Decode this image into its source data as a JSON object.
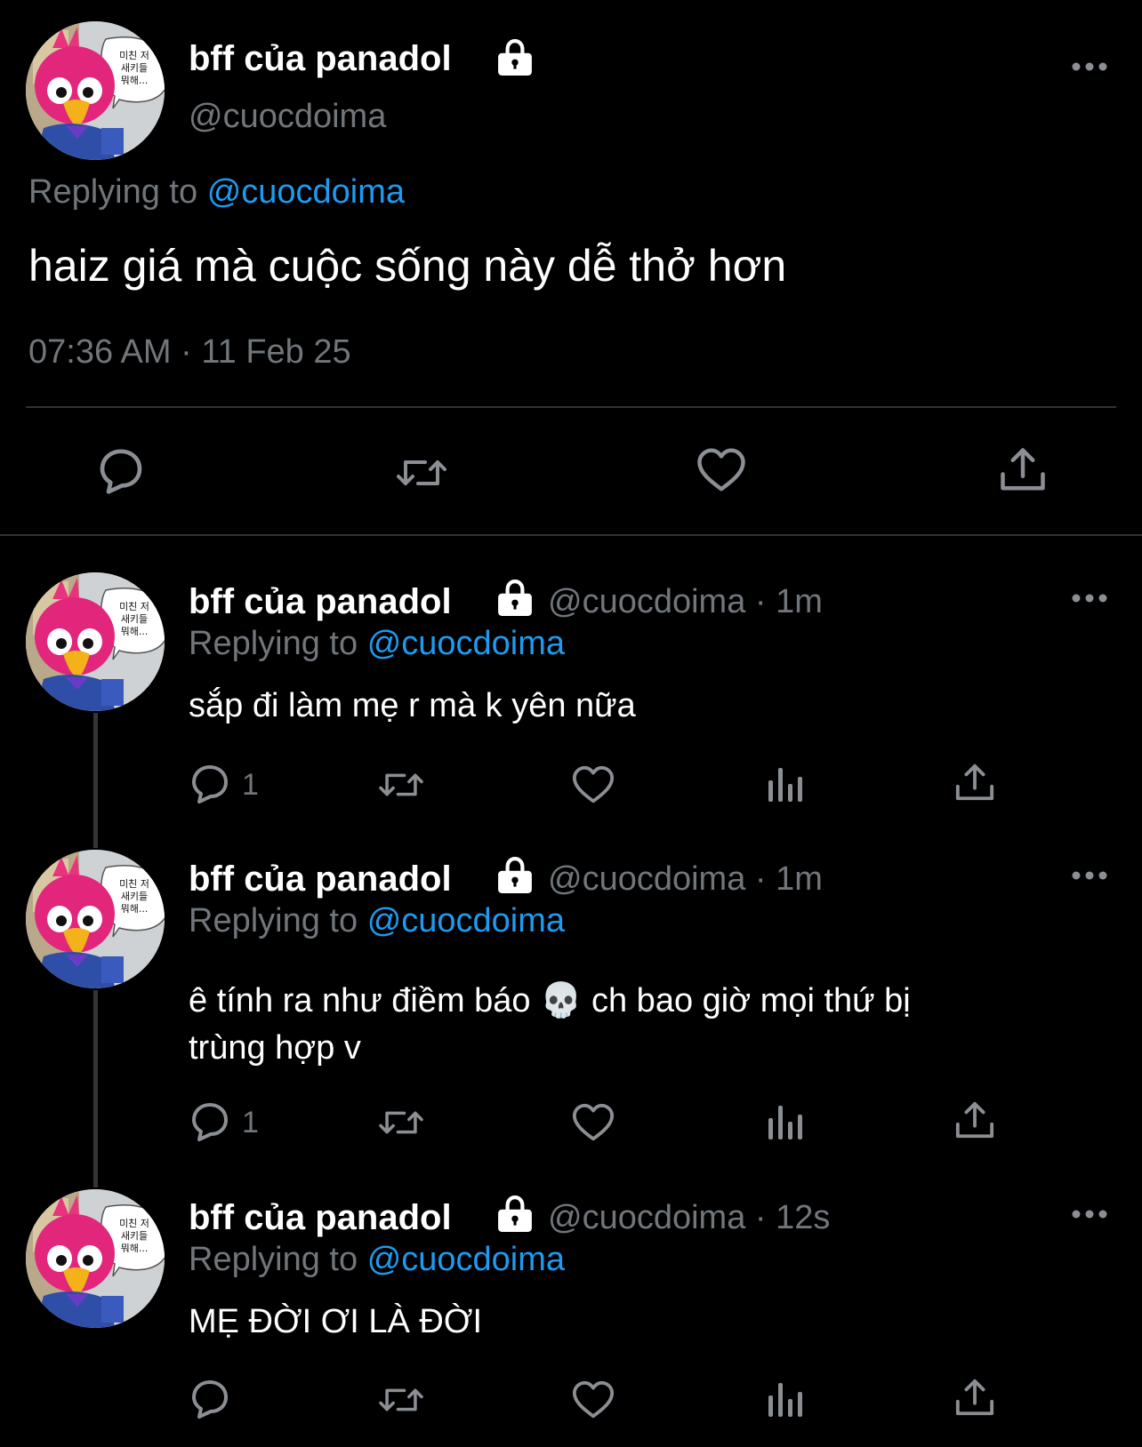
{
  "main_tweet": {
    "display_name": "bff của panadol",
    "handle": "@cuocdoima",
    "replying_prefix": "Replying to",
    "replying_handle": "@cuocdoima",
    "text": "haiz giá mà cuộc sống này dễ thở hơn",
    "timestamp": "07:36 AM · 11 Feb 25"
  },
  "avatar_speech": "미친 저\n새키들\n뭐해...",
  "replies": [
    {
      "display_name": "bff của panadol",
      "meta": "@cuocdoima · 1m",
      "replying_prefix": "Replying to",
      "replying_handle": "@cuocdoima",
      "text_lines": [
        "sắp đi làm mẹ r mà k yên nữa"
      ],
      "reply_count": "1"
    },
    {
      "display_name": "bff của panadol",
      "meta": "@cuocdoima · 1m",
      "replying_prefix": "Replying to",
      "replying_handle": "@cuocdoima",
      "text_lines": [
        "ê tính ra như điềm báo 💀  ch bao giờ mọi thứ bị",
        "trùng hợp v"
      ],
      "reply_count": "1"
    },
    {
      "display_name": "bff của panadol",
      "meta": "@cuocdoima · 12s",
      "replying_prefix": "Replying to",
      "replying_handle": "@cuocdoima",
      "text_lines": [
        "MẸ ĐỜI ƠI LÀ ĐỜI"
      ],
      "reply_count": ""
    }
  ],
  "icons": {
    "reply": "reply-icon",
    "retweet": "retweet-icon",
    "like": "heart-icon",
    "share": "share-icon",
    "views": "views-icon",
    "lock": "lock-icon",
    "more": "more-icon"
  },
  "colors": {
    "background": "#000000",
    "muted": "#71767b",
    "link": "#1d9bf0",
    "text": "#ffffff"
  }
}
